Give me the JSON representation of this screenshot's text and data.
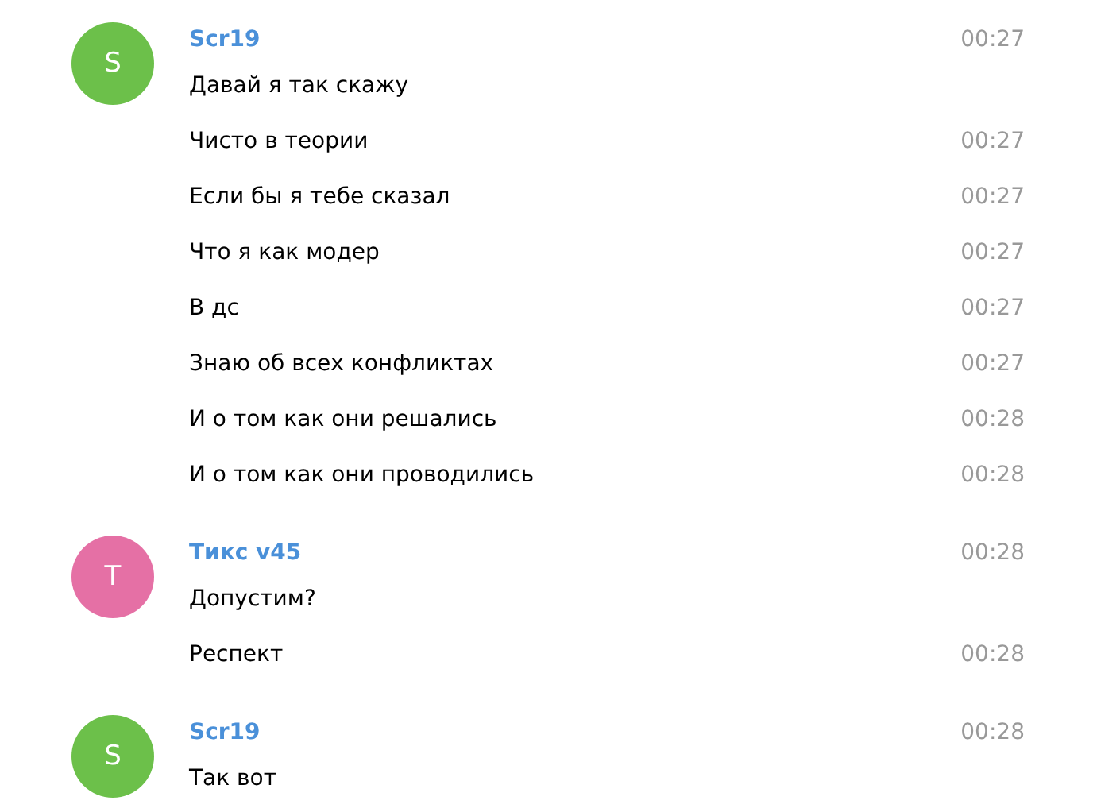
{
  "groups": [
    {
      "author": "Scr19",
      "initial": "S",
      "color": "#6cc04a",
      "time": "00:27",
      "messages": [
        {
          "text": "Давай я так скажу"
        },
        {
          "text": "Чисто в теории",
          "time": "00:27"
        },
        {
          "text": "Если бы я тебе сказал",
          "time": "00:27"
        },
        {
          "text": "Что я как модер",
          "time": "00:27"
        },
        {
          "text": "В дс",
          "time": "00:27"
        },
        {
          "text": "Знаю об всех конфликтах",
          "time": "00:27"
        },
        {
          "text": "И о том как они решались",
          "time": "00:28"
        },
        {
          "text": "И о том как они проводились",
          "time": "00:28"
        }
      ]
    },
    {
      "author": "Тикс v45",
      "initial": "T",
      "color": "#e570a5",
      "time": "00:28",
      "messages": [
        {
          "text": "Допустим?"
        },
        {
          "text": "Респект",
          "time": "00:28"
        }
      ]
    },
    {
      "author": "Scr19",
      "initial": "S",
      "color": "#6cc04a",
      "time": "00:28",
      "messages": [
        {
          "text": "Так вот"
        }
      ]
    }
  ]
}
